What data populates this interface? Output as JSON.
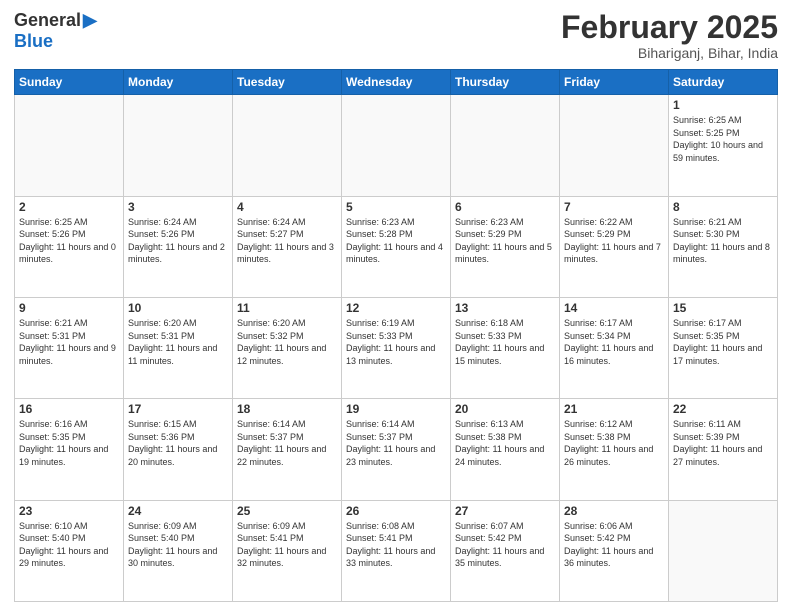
{
  "header": {
    "logo_line1": "General",
    "logo_line2": "Blue",
    "month": "February 2025",
    "location": "Bihariganj, Bihar, India"
  },
  "weekdays": [
    "Sunday",
    "Monday",
    "Tuesday",
    "Wednesday",
    "Thursday",
    "Friday",
    "Saturday"
  ],
  "weeks": [
    [
      {
        "day": "",
        "info": ""
      },
      {
        "day": "",
        "info": ""
      },
      {
        "day": "",
        "info": ""
      },
      {
        "day": "",
        "info": ""
      },
      {
        "day": "",
        "info": ""
      },
      {
        "day": "",
        "info": ""
      },
      {
        "day": "1",
        "info": "Sunrise: 6:25 AM\nSunset: 5:25 PM\nDaylight: 10 hours and 59 minutes."
      }
    ],
    [
      {
        "day": "2",
        "info": "Sunrise: 6:25 AM\nSunset: 5:26 PM\nDaylight: 11 hours and 0 minutes."
      },
      {
        "day": "3",
        "info": "Sunrise: 6:24 AM\nSunset: 5:26 PM\nDaylight: 11 hours and 2 minutes."
      },
      {
        "day": "4",
        "info": "Sunrise: 6:24 AM\nSunset: 5:27 PM\nDaylight: 11 hours and 3 minutes."
      },
      {
        "day": "5",
        "info": "Sunrise: 6:23 AM\nSunset: 5:28 PM\nDaylight: 11 hours and 4 minutes."
      },
      {
        "day": "6",
        "info": "Sunrise: 6:23 AM\nSunset: 5:29 PM\nDaylight: 11 hours and 5 minutes."
      },
      {
        "day": "7",
        "info": "Sunrise: 6:22 AM\nSunset: 5:29 PM\nDaylight: 11 hours and 7 minutes."
      },
      {
        "day": "8",
        "info": "Sunrise: 6:21 AM\nSunset: 5:30 PM\nDaylight: 11 hours and 8 minutes."
      }
    ],
    [
      {
        "day": "9",
        "info": "Sunrise: 6:21 AM\nSunset: 5:31 PM\nDaylight: 11 hours and 9 minutes."
      },
      {
        "day": "10",
        "info": "Sunrise: 6:20 AM\nSunset: 5:31 PM\nDaylight: 11 hours and 11 minutes."
      },
      {
        "day": "11",
        "info": "Sunrise: 6:20 AM\nSunset: 5:32 PM\nDaylight: 11 hours and 12 minutes."
      },
      {
        "day": "12",
        "info": "Sunrise: 6:19 AM\nSunset: 5:33 PM\nDaylight: 11 hours and 13 minutes."
      },
      {
        "day": "13",
        "info": "Sunrise: 6:18 AM\nSunset: 5:33 PM\nDaylight: 11 hours and 15 minutes."
      },
      {
        "day": "14",
        "info": "Sunrise: 6:17 AM\nSunset: 5:34 PM\nDaylight: 11 hours and 16 minutes."
      },
      {
        "day": "15",
        "info": "Sunrise: 6:17 AM\nSunset: 5:35 PM\nDaylight: 11 hours and 17 minutes."
      }
    ],
    [
      {
        "day": "16",
        "info": "Sunrise: 6:16 AM\nSunset: 5:35 PM\nDaylight: 11 hours and 19 minutes."
      },
      {
        "day": "17",
        "info": "Sunrise: 6:15 AM\nSunset: 5:36 PM\nDaylight: 11 hours and 20 minutes."
      },
      {
        "day": "18",
        "info": "Sunrise: 6:14 AM\nSunset: 5:37 PM\nDaylight: 11 hours and 22 minutes."
      },
      {
        "day": "19",
        "info": "Sunrise: 6:14 AM\nSunset: 5:37 PM\nDaylight: 11 hours and 23 minutes."
      },
      {
        "day": "20",
        "info": "Sunrise: 6:13 AM\nSunset: 5:38 PM\nDaylight: 11 hours and 24 minutes."
      },
      {
        "day": "21",
        "info": "Sunrise: 6:12 AM\nSunset: 5:38 PM\nDaylight: 11 hours and 26 minutes."
      },
      {
        "day": "22",
        "info": "Sunrise: 6:11 AM\nSunset: 5:39 PM\nDaylight: 11 hours and 27 minutes."
      }
    ],
    [
      {
        "day": "23",
        "info": "Sunrise: 6:10 AM\nSunset: 5:40 PM\nDaylight: 11 hours and 29 minutes."
      },
      {
        "day": "24",
        "info": "Sunrise: 6:09 AM\nSunset: 5:40 PM\nDaylight: 11 hours and 30 minutes."
      },
      {
        "day": "25",
        "info": "Sunrise: 6:09 AM\nSunset: 5:41 PM\nDaylight: 11 hours and 32 minutes."
      },
      {
        "day": "26",
        "info": "Sunrise: 6:08 AM\nSunset: 5:41 PM\nDaylight: 11 hours and 33 minutes."
      },
      {
        "day": "27",
        "info": "Sunrise: 6:07 AM\nSunset: 5:42 PM\nDaylight: 11 hours and 35 minutes."
      },
      {
        "day": "28",
        "info": "Sunrise: 6:06 AM\nSunset: 5:42 PM\nDaylight: 11 hours and 36 minutes."
      },
      {
        "day": "",
        "info": ""
      }
    ]
  ]
}
